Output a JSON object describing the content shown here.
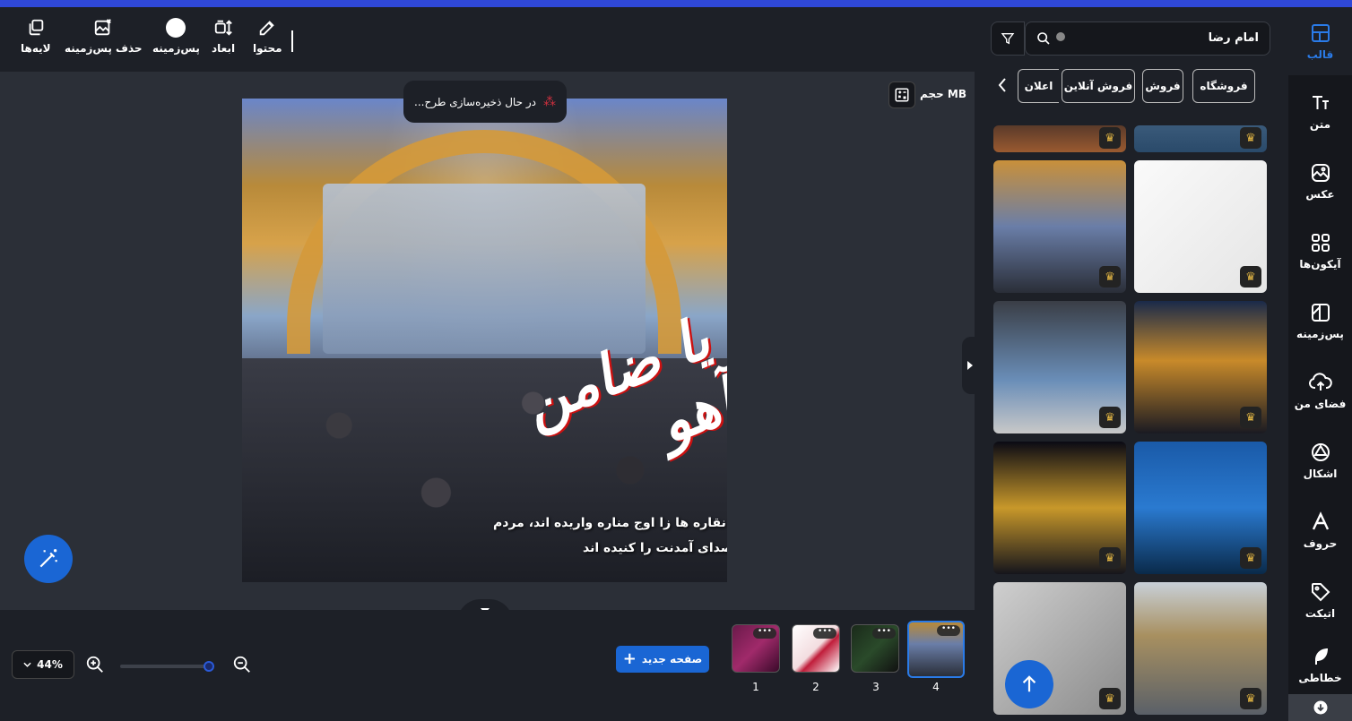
{
  "toolbar": {
    "content": "محتوا",
    "dimensions": "ابعاد",
    "background": "پس‌زمینه",
    "remove_background": "حذف پس‌زمینه",
    "layers": "لایه‌ها"
  },
  "canvas": {
    "saving_status": "در حال ذخیره‌سازی طرح...",
    "size_label": "حجم MB",
    "design_calligraphy": "یا ضامن آهو",
    "design_caption_1": "نقاره ها زا اوج مناره واریده اند، مردم",
    "design_caption_2": "صدای آمدنت را کنیده اند"
  },
  "bottom": {
    "zoom_value": "44%",
    "zoom_level": 0.44,
    "new_page": "صفحه جدید",
    "pages": [
      {
        "number": "1",
        "selected": false
      },
      {
        "number": "2",
        "selected": false
      },
      {
        "number": "3",
        "selected": false
      },
      {
        "number": "4",
        "selected": true
      }
    ]
  },
  "panel": {
    "search_value": "امام رضا",
    "chips": [
      "فروشگاه",
      "فروش",
      "فروش آنلاین",
      "اعلان"
    ]
  },
  "nav": {
    "items": [
      {
        "label": "قالب",
        "icon": "template-icon",
        "active": true
      },
      {
        "label": "متن",
        "icon": "text-icon",
        "active": false
      },
      {
        "label": "عکس",
        "icon": "photo-icon",
        "active": false
      },
      {
        "label": "آیکون‌ها",
        "icon": "icons-icon",
        "active": false
      },
      {
        "label": "پس‌زمینه",
        "icon": "background-icon",
        "active": false
      },
      {
        "label": "فضای من",
        "icon": "upload-icon",
        "active": false
      },
      {
        "label": "اشکال",
        "icon": "shapes-icon",
        "active": false
      },
      {
        "label": "حروف",
        "icon": "letters-icon",
        "active": false
      },
      {
        "label": "اتیکت",
        "icon": "tag-icon",
        "active": false
      },
      {
        "label": "خطاطی",
        "icon": "feather-icon",
        "active": false
      }
    ]
  },
  "colors": {
    "accent": "#1a66d4",
    "top_stripe": "#2f48d8",
    "panel_bg": "#1d2027",
    "canvas_bg": "#2b2f37"
  }
}
